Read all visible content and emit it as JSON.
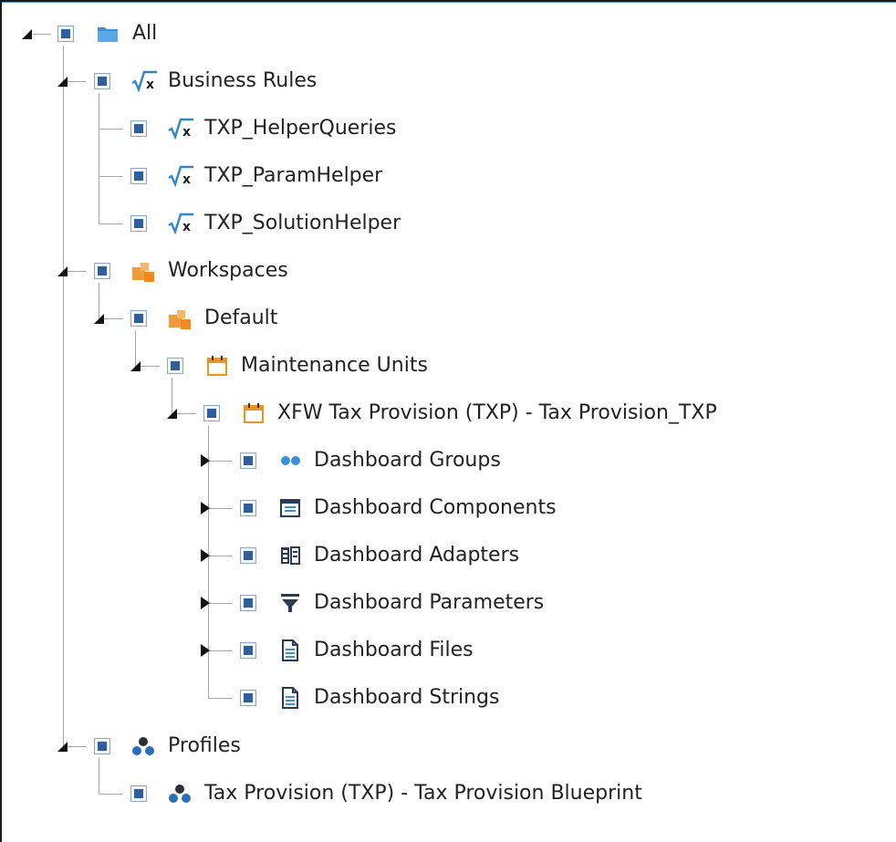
{
  "tree": {
    "all": {
      "label": "All",
      "icon": "folder-icon"
    },
    "business_rules": {
      "label": "Business Rules",
      "icon": "formula-icon"
    },
    "helper_queries": {
      "label": "TXP_HelperQueries",
      "icon": "formula-icon"
    },
    "param_helper": {
      "label": "TXP_ParamHelper",
      "icon": "formula-icon"
    },
    "solution_helper": {
      "label": "TXP_SolutionHelper",
      "icon": "formula-icon"
    },
    "workspaces": {
      "label": "Workspaces",
      "icon": "workspace-icon"
    },
    "default": {
      "label": "Default",
      "icon": "workspace-icon"
    },
    "maintenance_units": {
      "label": "Maintenance Units",
      "icon": "maintenance-unit-icon"
    },
    "xfw_tax_provision": {
      "label": "XFW Tax Provision (TXP) - Tax Provision_TXP",
      "icon": "maintenance-unit-icon"
    },
    "dashboard_groups": {
      "label": "Dashboard Groups",
      "icon": "dashboard-groups-icon"
    },
    "dashboard_components": {
      "label": "Dashboard Components",
      "icon": "dashboard-components-icon"
    },
    "dashboard_adapters": {
      "label": "Dashboard Adapters",
      "icon": "dashboard-adapters-icon"
    },
    "dashboard_parameters": {
      "label": "Dashboard Parameters",
      "icon": "dashboard-parameters-icon"
    },
    "dashboard_files": {
      "label": "Dashboard Files",
      "icon": "document-icon"
    },
    "dashboard_strings": {
      "label": "Dashboard Strings",
      "icon": "document-icon"
    },
    "profiles": {
      "label": "Profiles",
      "icon": "profiles-icon"
    },
    "tax_provision_blueprint": {
      "label": "Tax Provision (TXP) - Tax Provision Blueprint",
      "icon": "profiles-icon"
    }
  },
  "colors": {
    "checkbox_fill": "#2d5f9e",
    "folder_blue": "#3a8fd8",
    "workspace_orange": "#f39a3a",
    "maintenance_orange": "#e8961e",
    "profiles_blue": "#2a6fb8",
    "guide_line": "#a9a9a9"
  }
}
